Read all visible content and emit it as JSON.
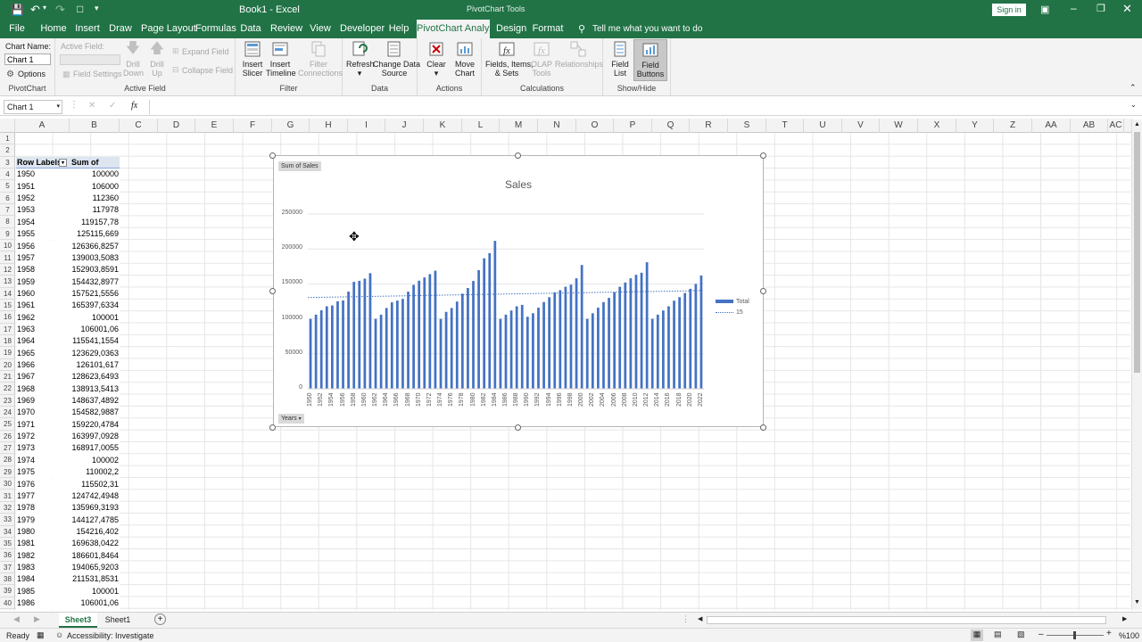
{
  "titlebar": {
    "title": "Book1  -  Excel",
    "context": "PivotChart Tools",
    "signin": "Sign in"
  },
  "tabs": [
    "File",
    "Home",
    "Insert",
    "Draw",
    "Page Layout",
    "Formulas",
    "Data",
    "Review",
    "View",
    "Developer",
    "Help",
    "PivotChart Analyze",
    "Design",
    "Format"
  ],
  "tellme": "Tell me what you want to do",
  "ribbon": {
    "pivotchart": {
      "chart_name_label": "Chart Name:",
      "chart_name": "Chart 1",
      "options": "Options",
      "label": "PivotChart"
    },
    "activefield": {
      "active_field": "Active Field:",
      "field_settings": "Field Settings",
      "drill_down": [
        "Drill",
        "Down"
      ],
      "drill_up": [
        "Drill",
        "Up"
      ],
      "expand": "Expand Field",
      "collapse": "Collapse Field",
      "label": "Active Field"
    },
    "filter": {
      "insert_slicer": [
        "Insert",
        "Slicer"
      ],
      "insert_timeline": [
        "Insert",
        "Timeline"
      ],
      "filter_connections": [
        "Filter",
        "Connections"
      ],
      "label": "Filter"
    },
    "data": {
      "refresh": "Refresh",
      "change_data_source": [
        "Change Data",
        "Source"
      ],
      "label": "Data"
    },
    "actions": {
      "clear": "Clear",
      "move_chart": [
        "Move",
        "Chart"
      ],
      "label": "Actions"
    },
    "calculations": {
      "fields_items": [
        "Fields, Items,",
        "& Sets"
      ],
      "olap_tools": [
        "OLAP",
        "Tools"
      ],
      "relationships": "Relationships",
      "label": "Calculations"
    },
    "showhide": {
      "field_list": [
        "Field",
        "List"
      ],
      "field_buttons": [
        "Field",
        "Buttons"
      ],
      "label": "Show/Hide"
    }
  },
  "formula_bar": {
    "name_box": "Chart 1",
    "fx": "fx",
    "value": ""
  },
  "columns": [
    "A",
    "B",
    "C",
    "D",
    "E",
    "F",
    "G",
    "H",
    "I",
    "J",
    "K",
    "L",
    "M",
    "N",
    "O",
    "P",
    "Q",
    "R",
    "S",
    "T",
    "U",
    "V",
    "W",
    "X",
    "Y",
    "Z",
    "AA",
    "AB",
    "AC"
  ],
  "rows": [
    "1",
    "2",
    "3",
    "4",
    "5",
    "6",
    "7",
    "8",
    "9",
    "10",
    "11",
    "12",
    "13",
    "14",
    "15",
    "16",
    "17",
    "18",
    "19",
    "20",
    "21",
    "22",
    "23",
    "24",
    "25",
    "26",
    "27",
    "28",
    "29",
    "30",
    "31",
    "32",
    "33",
    "34",
    "35",
    "36",
    "37",
    "38",
    "39",
    "40"
  ],
  "pivot": {
    "header_a": "Row Labels",
    "header_b": "Sum of Sales",
    "rows": [
      [
        "1950",
        "100000"
      ],
      [
        "1951",
        "106000"
      ],
      [
        "1952",
        "112360"
      ],
      [
        "1953",
        "117978"
      ],
      [
        "1954",
        "119157,78"
      ],
      [
        "1955",
        "125115,669"
      ],
      [
        "1956",
        "126366,8257"
      ],
      [
        "1957",
        "139003,5083"
      ],
      [
        "1958",
        "152903,8591"
      ],
      [
        "1959",
        "154432,8977"
      ],
      [
        "1960",
        "157521,5556"
      ],
      [
        "1961",
        "165397,6334"
      ],
      [
        "1962",
        "100001"
      ],
      [
        "1963",
        "106001,06"
      ],
      [
        "1964",
        "115541,1554"
      ],
      [
        "1965",
        "123629,0363"
      ],
      [
        "1966",
        "126101,617"
      ],
      [
        "1967",
        "128623,6493"
      ],
      [
        "1968",
        "138913,5413"
      ],
      [
        "1969",
        "148637,4892"
      ],
      [
        "1970",
        "154582,9887"
      ],
      [
        "1971",
        "159220,4784"
      ],
      [
        "1972",
        "163997,0928"
      ],
      [
        "1973",
        "168917,0055"
      ],
      [
        "1974",
        "100002"
      ],
      [
        "1975",
        "110002,2"
      ],
      [
        "1976",
        "115502,31"
      ],
      [
        "1977",
        "124742,4948"
      ],
      [
        "1978",
        "135969,3193"
      ],
      [
        "1979",
        "144127,4785"
      ],
      [
        "1980",
        "154216,402"
      ],
      [
        "1981",
        "169638,0422"
      ],
      [
        "1982",
        "186601,8464"
      ],
      [
        "1983",
        "194065,9203"
      ],
      [
        "1984",
        "211531,8531"
      ],
      [
        "1985",
        "100001"
      ],
      [
        "1986",
        "106001,06"
      ]
    ]
  },
  "chart_data": {
    "type": "bar",
    "title": "Sales",
    "field_button_value": "Sum of Sales",
    "field_button_axis": "Years",
    "ylim": [
      0,
      250000
    ],
    "y_ticks": [
      "0",
      "50000",
      "100000",
      "150000",
      "200000",
      "250000"
    ],
    "categories": [
      "1950",
      "1951",
      "1952",
      "1953",
      "1954",
      "1955",
      "1956",
      "1957",
      "1958",
      "1959",
      "1960",
      "1961",
      "1962",
      "1963",
      "1964",
      "1965",
      "1966",
      "1967",
      "1968",
      "1969",
      "1970",
      "1971",
      "1972",
      "1973",
      "1974",
      "1975",
      "1976",
      "1977",
      "1978",
      "1979",
      "1980",
      "1981",
      "1982",
      "1983",
      "1984",
      "1985",
      "1986",
      "1987",
      "1988",
      "1989",
      "1990",
      "1991",
      "1992",
      "1993",
      "1994",
      "1995",
      "1996",
      "1997",
      "1998",
      "1999",
      "2000",
      "2001",
      "2002",
      "2003",
      "2004",
      "2005",
      "2006",
      "2007",
      "2008",
      "2009",
      "2010",
      "2011",
      "2012",
      "2013",
      "2014",
      "2015",
      "2016",
      "2017",
      "2018",
      "2019",
      "2020",
      "2021",
      "2022"
    ],
    "x_tick_labels": [
      "1950",
      "1952",
      "1954",
      "1956",
      "1958",
      "1960",
      "1962",
      "1964",
      "1966",
      "1968",
      "1970",
      "1972",
      "1974",
      "1976",
      "1978",
      "1980",
      "1982",
      "1984",
      "1986",
      "1988",
      "1990",
      "1992",
      "1994",
      "1996",
      "1998",
      "2000",
      "2002",
      "2004",
      "2006",
      "2008",
      "2010",
      "2012",
      "2014",
      "2016",
      "2018",
      "2020",
      "2022"
    ],
    "series": [
      {
        "name": "Total",
        "color": "#4472c4",
        "values": [
          100000,
          106000,
          112360,
          117978,
          119158,
          125116,
          126367,
          139004,
          152904,
          154433,
          157522,
          165398,
          100001,
          106001,
          115541,
          123629,
          126102,
          128624,
          138914,
          148637,
          154583,
          159220,
          163997,
          168917,
          100002,
          110002,
          115502,
          124742,
          135969,
          144127,
          154216,
          169638,
          186602,
          194066,
          211532,
          100001,
          106001,
          112000,
          118000,
          120000,
          103000,
          108000,
          116000,
          124000,
          131000,
          138000,
          141000,
          146000,
          149000,
          158000,
          177000,
          100002,
          108000,
          116000,
          124000,
          130000,
          138000,
          146000,
          152000,
          158000,
          163000,
          166000,
          181000,
          100003,
          106000,
          112000,
          118000,
          126000,
          131000,
          137000,
          143000,
          150000,
          162000
        ]
      },
      {
        "name": "15",
        "color": "#4472c4",
        "type": "trendline",
        "values": [
          130500,
          140500
        ]
      }
    ],
    "legend": "right",
    "gridlines": true
  },
  "sheets": {
    "active": "Sheet3",
    "other": "Sheet1"
  },
  "status": {
    "ready": "Ready",
    "accessibility": "Accessibility: Investigate",
    "zoom": "%100"
  }
}
